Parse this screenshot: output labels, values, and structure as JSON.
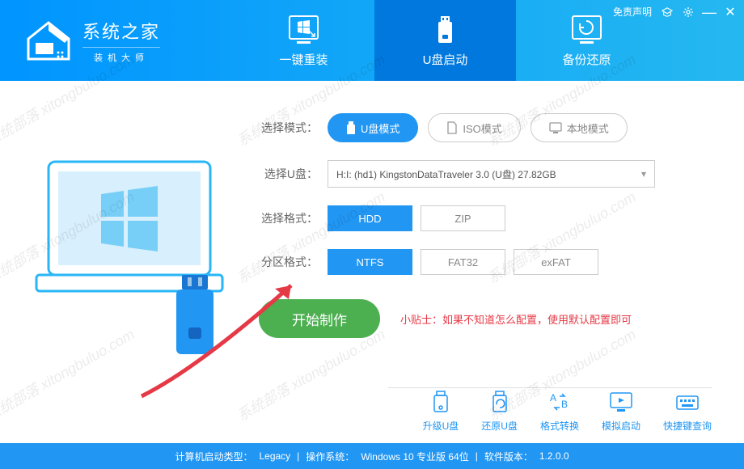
{
  "header": {
    "logo_title": "系统之家",
    "logo_subtitle": "装机大师",
    "disclaimer": "免责声明"
  },
  "tabs": [
    {
      "label": "一键重装"
    },
    {
      "label": "U盘启动"
    },
    {
      "label": "备份还原"
    }
  ],
  "form": {
    "mode_label": "选择模式：",
    "modes": [
      {
        "label": "U盘模式"
      },
      {
        "label": "ISO模式"
      },
      {
        "label": "本地模式"
      }
    ],
    "usb_label": "选择U盘：",
    "usb_value": "H:I: (hd1) KingstonDataTraveler 3.0 (U盘) 27.82GB",
    "format_label": "选择格式：",
    "formats": [
      {
        "label": "HDD"
      },
      {
        "label": "ZIP"
      }
    ],
    "partition_label": "分区格式：",
    "partitions": [
      {
        "label": "NTFS"
      },
      {
        "label": "FAT32"
      },
      {
        "label": "exFAT"
      }
    ]
  },
  "action": {
    "start_label": "开始制作",
    "tip": "小贴士：如果不知道怎么配置，使用默认配置即可"
  },
  "tools": [
    {
      "label": "升级U盘"
    },
    {
      "label": "还原U盘"
    },
    {
      "label": "格式转换"
    },
    {
      "label": "模拟启动"
    },
    {
      "label": "快捷键查询"
    }
  ],
  "footer": {
    "boot_type_label": "计算机启动类型：",
    "boot_type_value": "Legacy",
    "os_label": "操作系统：",
    "os_value": "Windows 10 专业版 64位",
    "version_label": "软件版本：",
    "version_value": "1.2.0.0"
  },
  "watermark": "系统部落 xitongbuluo.com"
}
